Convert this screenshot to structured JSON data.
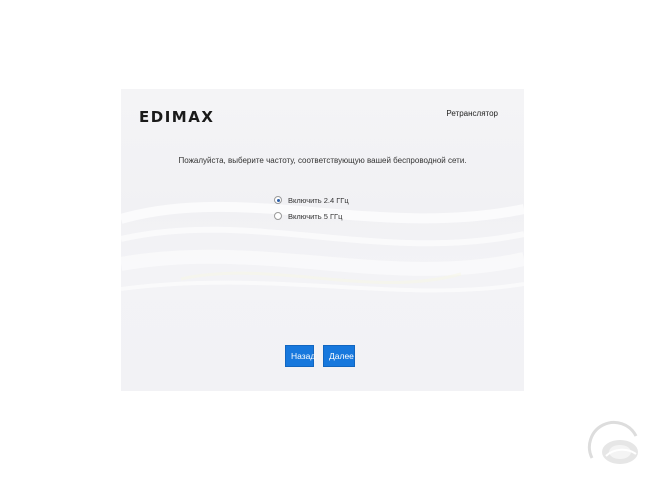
{
  "header": {
    "logo_text": "EDIMAX",
    "mode_label": "Ретранслятор"
  },
  "main": {
    "instruction": "Пожалуйста, выберите частоту, соответствующую вашей беспроводной сети.",
    "options": [
      {
        "label": "Включить 2.4 ГГц",
        "selected": true
      },
      {
        "label": "Включить 5 ГГц",
        "selected": false
      }
    ]
  },
  "buttons": {
    "back_label": "Назад",
    "next_label": "Далее"
  },
  "colors": {
    "button_bg": "#1778dd",
    "radio_selected": "#2a5ea8",
    "panel_bg": "#f2f2f5"
  }
}
